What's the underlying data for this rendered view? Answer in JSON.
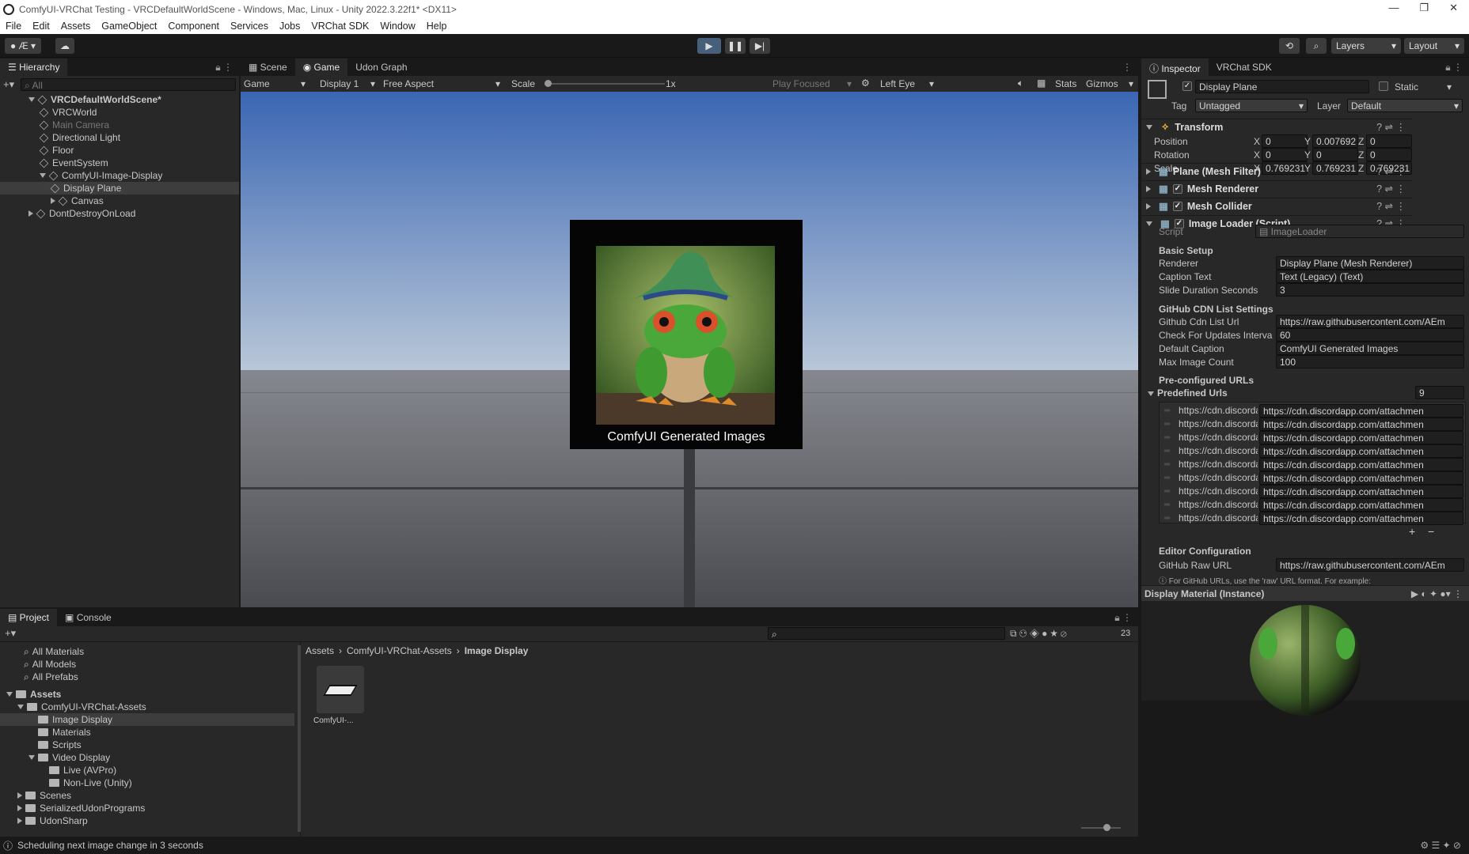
{
  "window": {
    "title": "ComfyUI-VRChat Testing - VRCDefaultWorldScene - Windows, Mac, Linux - Unity 2022.3.22f1* <DX11>",
    "min": "—",
    "max": "❐",
    "close": "✕"
  },
  "menu": [
    "File",
    "Edit",
    "Assets",
    "GameObject",
    "Component",
    "Services",
    "Jobs",
    "VRChat SDK",
    "Window",
    "Help"
  ],
  "toolbar": {
    "layers": "Layers",
    "layout": "Layout",
    "account_initial": "Æ"
  },
  "hierarchy": {
    "tab": "Hierarchy",
    "search_placeholder": "All",
    "items": [
      {
        "label": "VRCDefaultWorldScene*",
        "depth": 0,
        "bold": true
      },
      {
        "label": "VRCWorld",
        "depth": 1
      },
      {
        "label": "Main Camera",
        "depth": 1,
        "dim": true
      },
      {
        "label": "Directional Light",
        "depth": 1
      },
      {
        "label": "Floor",
        "depth": 1
      },
      {
        "label": "EventSystem",
        "depth": 1
      },
      {
        "label": "ComfyUI-Image-Display",
        "depth": 1
      },
      {
        "label": "Display Plane",
        "depth": 2,
        "selected": true
      },
      {
        "label": "Canvas",
        "depth": 2
      },
      {
        "label": "DontDestroyOnLoad",
        "depth": 0
      }
    ]
  },
  "scene_tabs": [
    "Scene",
    "Game",
    "Udon Graph"
  ],
  "game_bar": {
    "mode": "Game",
    "display": "Display 1",
    "aspect": "Free Aspect",
    "scale_label": "Scale",
    "scale_value": "1x",
    "play_focused": "Play Focused",
    "eye": "Left Eye",
    "stats": "Stats",
    "gizmos": "Gizmos"
  },
  "game_view": {
    "caption": "ComfyUI Generated Images",
    "sky_top": "#3a66b3",
    "sky_bottom": "#b9c7d8",
    "floor": "#4a4b50"
  },
  "inspector": {
    "tabs": [
      "Inspector",
      "VRChat SDK"
    ],
    "object_name": "Display Plane",
    "static": "Static",
    "tag_label": "Tag",
    "tag": "Untagged",
    "layer_label": "Layer",
    "layer": "Default",
    "transform": {
      "title": "Transform",
      "rows": [
        {
          "label": "Position",
          "x": "0",
          "y": "0.007692",
          "z": "0"
        },
        {
          "label": "Rotation",
          "x": "0",
          "y": "0",
          "z": "0"
        },
        {
          "label": "Scale",
          "x": "0.769231",
          "y": "0.769231",
          "z": "0.769231"
        }
      ]
    },
    "components": [
      "Plane (Mesh Filter)",
      "Mesh Renderer",
      "Mesh Collider",
      "Image Loader (Script)"
    ],
    "script": {
      "label": "Script",
      "value": "ImageLoader"
    },
    "basic_setup": "Basic Setup",
    "fields1": [
      {
        "label": "Renderer",
        "value": "Display Plane (Mesh Renderer)"
      },
      {
        "label": "Caption Text",
        "value": "Text (Legacy) (Text)"
      },
      {
        "label": "Slide Duration Seconds",
        "value": "3"
      }
    ],
    "cdn_header": "GitHub CDN List Settings",
    "fields2": [
      {
        "label": "Github Cdn List Url",
        "value": "https://raw.githubusercontent.com/AEm"
      },
      {
        "label": "Check For Updates Interva",
        "value": "60"
      },
      {
        "label": "Default Caption",
        "value": "ComfyUI Generated Images"
      },
      {
        "label": "Max Image Count",
        "value": "100"
      }
    ],
    "preconfig_header": "Pre-configured URLs",
    "predefined": {
      "label": "Predefined Urls",
      "count": "9",
      "left": "https://cdn.discordap",
      "right": "https://cdn.discordapp.com/attachmen"
    },
    "editor_header": "Editor Configuration",
    "raw_url": {
      "label": "GitHub Raw URL",
      "value": "https://raw.githubusercontent.com/AEm"
    },
    "help": "For GitHub URLs, use the 'raw' URL format. For example:",
    "material": "Display Material (Instance)"
  },
  "project": {
    "tabs": [
      "Project",
      "Console"
    ],
    "favorites": [
      "All Materials",
      "All Models",
      "All Prefabs"
    ],
    "tree": [
      {
        "label": "Assets",
        "depth": 0,
        "bold": true
      },
      {
        "label": "ComfyUI-VRChat-Assets",
        "depth": 1
      },
      {
        "label": "Image Display",
        "depth": 2,
        "selected": true
      },
      {
        "label": "Materials",
        "depth": 2
      },
      {
        "label": "Scripts",
        "depth": 2
      },
      {
        "label": "Video Display",
        "depth": 2
      },
      {
        "label": "Live (AVPro)",
        "depth": 3
      },
      {
        "label": "Non-Live (Unity)",
        "depth": 3
      },
      {
        "label": "Scenes",
        "depth": 1
      },
      {
        "label": "SerializedUdonPrograms",
        "depth": 1
      },
      {
        "label": "UdonSharp",
        "depth": 1
      }
    ],
    "breadcrumb": [
      "Assets",
      "ComfyUI-VRChat-Assets",
      "Image Display"
    ],
    "asset_label": "ComfyUI-...",
    "hidden_count": "23"
  },
  "status": "Scheduling next image change in 3 seconds"
}
